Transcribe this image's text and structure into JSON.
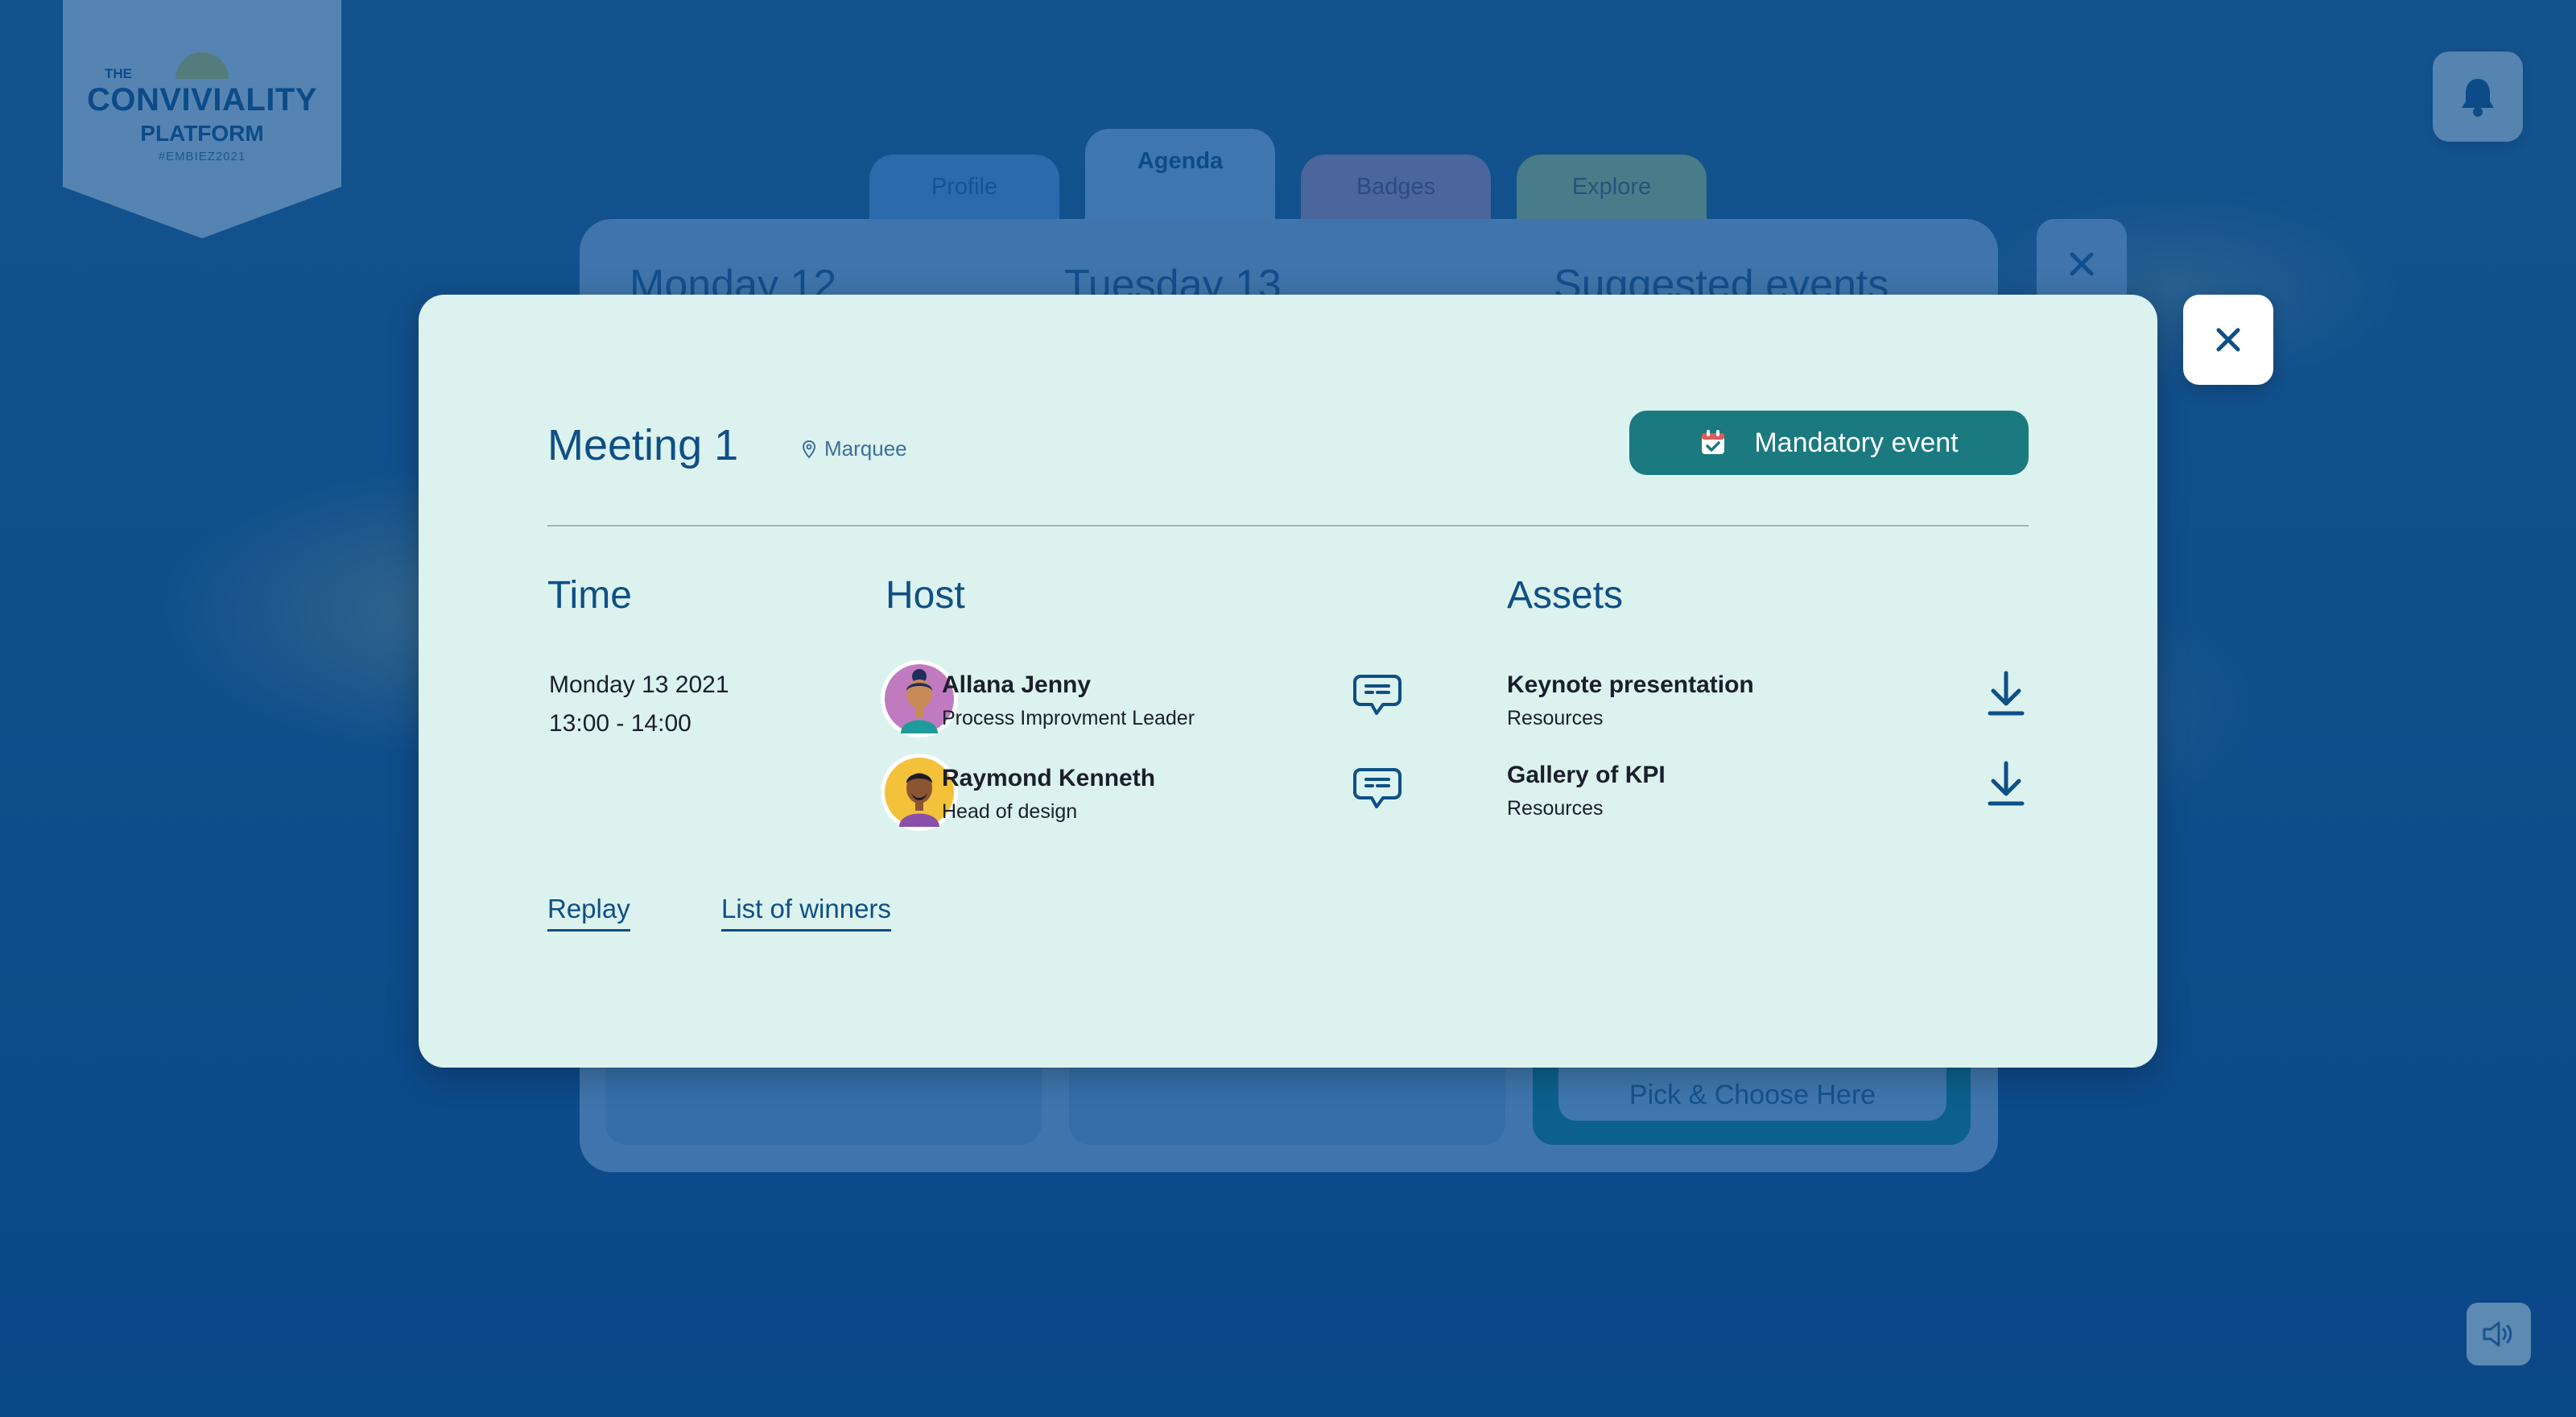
{
  "logo": {
    "line1": "THE",
    "line2": "CONVIVIALITY",
    "line3": "PLATFORM",
    "tag": "#EMBIEZ2021"
  },
  "tabs": [
    {
      "label": "Profile"
    },
    {
      "label": "Agenda"
    },
    {
      "label": "Badges"
    },
    {
      "label": "Explore"
    }
  ],
  "agenda_panel": {
    "columns": [
      "Monday 12",
      "Tuesday 13",
      "Suggested events"
    ],
    "pick_label": "Pick & Choose Here"
  },
  "modal": {
    "title": "Meeting 1",
    "location": "Marquee",
    "mandatory_label": "Mandatory event",
    "time": {
      "heading": "Time",
      "date": "Monday 13 2021",
      "range": "13:00 - 14:00"
    },
    "host": {
      "heading": "Host",
      "people": [
        {
          "name": "Allana Jenny",
          "role": "Process Improvment Leader"
        },
        {
          "name": "Raymond Kenneth",
          "role": "Head of design"
        }
      ]
    },
    "assets": {
      "heading": "Assets",
      "items": [
        {
          "name": "Keynote presentation",
          "type": "Resources"
        },
        {
          "name": "Gallery of KPI",
          "type": "Resources"
        }
      ]
    },
    "links": {
      "replay": "Replay",
      "winners": "List of winners"
    }
  },
  "colors": {
    "accent": "#0e4f86",
    "mandatory": "#1a7a80",
    "modal_bg": "#dcf2ee"
  },
  "icons": [
    "bell-icon",
    "speaker-icon",
    "close-icon",
    "location-pin-icon",
    "calendar-check-icon",
    "chat-icon",
    "download-icon"
  ]
}
